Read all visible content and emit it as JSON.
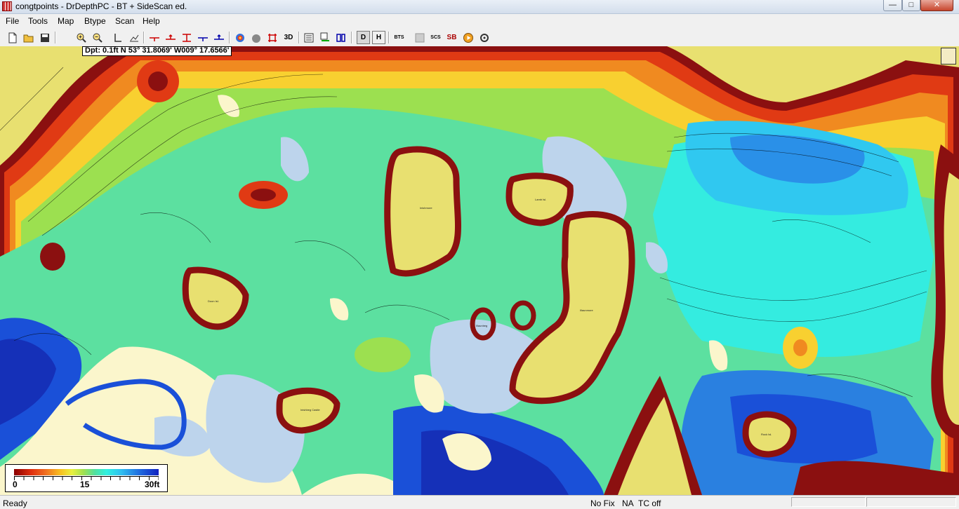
{
  "window": {
    "title": "congtpoints - DrDepthPC - BT + SideScan ed."
  },
  "window_controls": {
    "minimize": "—",
    "maximize": "□",
    "close": "✕"
  },
  "menu": [
    "File",
    "Tools",
    "Map",
    "Btype",
    "Scan",
    "Help"
  ],
  "toolbar": {
    "buttons": [
      {
        "name": "new-icon"
      },
      {
        "name": "open-folder-icon"
      },
      {
        "name": "save-icon"
      },
      {
        "name": "zoom-in-icon"
      },
      {
        "name": "zoom-out-icon"
      },
      {
        "name": "measure-l-icon"
      },
      {
        "name": "profile-icon"
      },
      {
        "name": "red-marker-icon"
      },
      {
        "name": "red-up-marker-icon"
      },
      {
        "name": "red-range-marker-icon"
      },
      {
        "name": "blue-marker-icon"
      },
      {
        "name": "blue-up-marker-icon"
      },
      {
        "name": "depth-color-icon"
      },
      {
        "name": "hardness-icon"
      },
      {
        "name": "grid-cross-icon"
      }
    ],
    "label_3d": "3D",
    "label_d": "D",
    "label_h": "H",
    "label_bts": "BTS",
    "label_scs": "SCS",
    "label_sb": "SB"
  },
  "map": {
    "readout": "Dpt: 0.1ft N 53° 31.8069' W009° 17.6566'",
    "scale": {
      "min_label": "0",
      "mid_label": "15",
      "max_label": "30ft"
    },
    "islands": [
      "Inishmore",
      "Lamb Isl.",
      "Doon Isl.",
      "Illaunbeg",
      "Illaunmore",
      "Inishbeg Castle",
      "Rock Isl."
    ]
  },
  "status": {
    "ready": "Ready",
    "fix": "No Fix",
    "na": "NA",
    "tc": "TC off"
  }
}
